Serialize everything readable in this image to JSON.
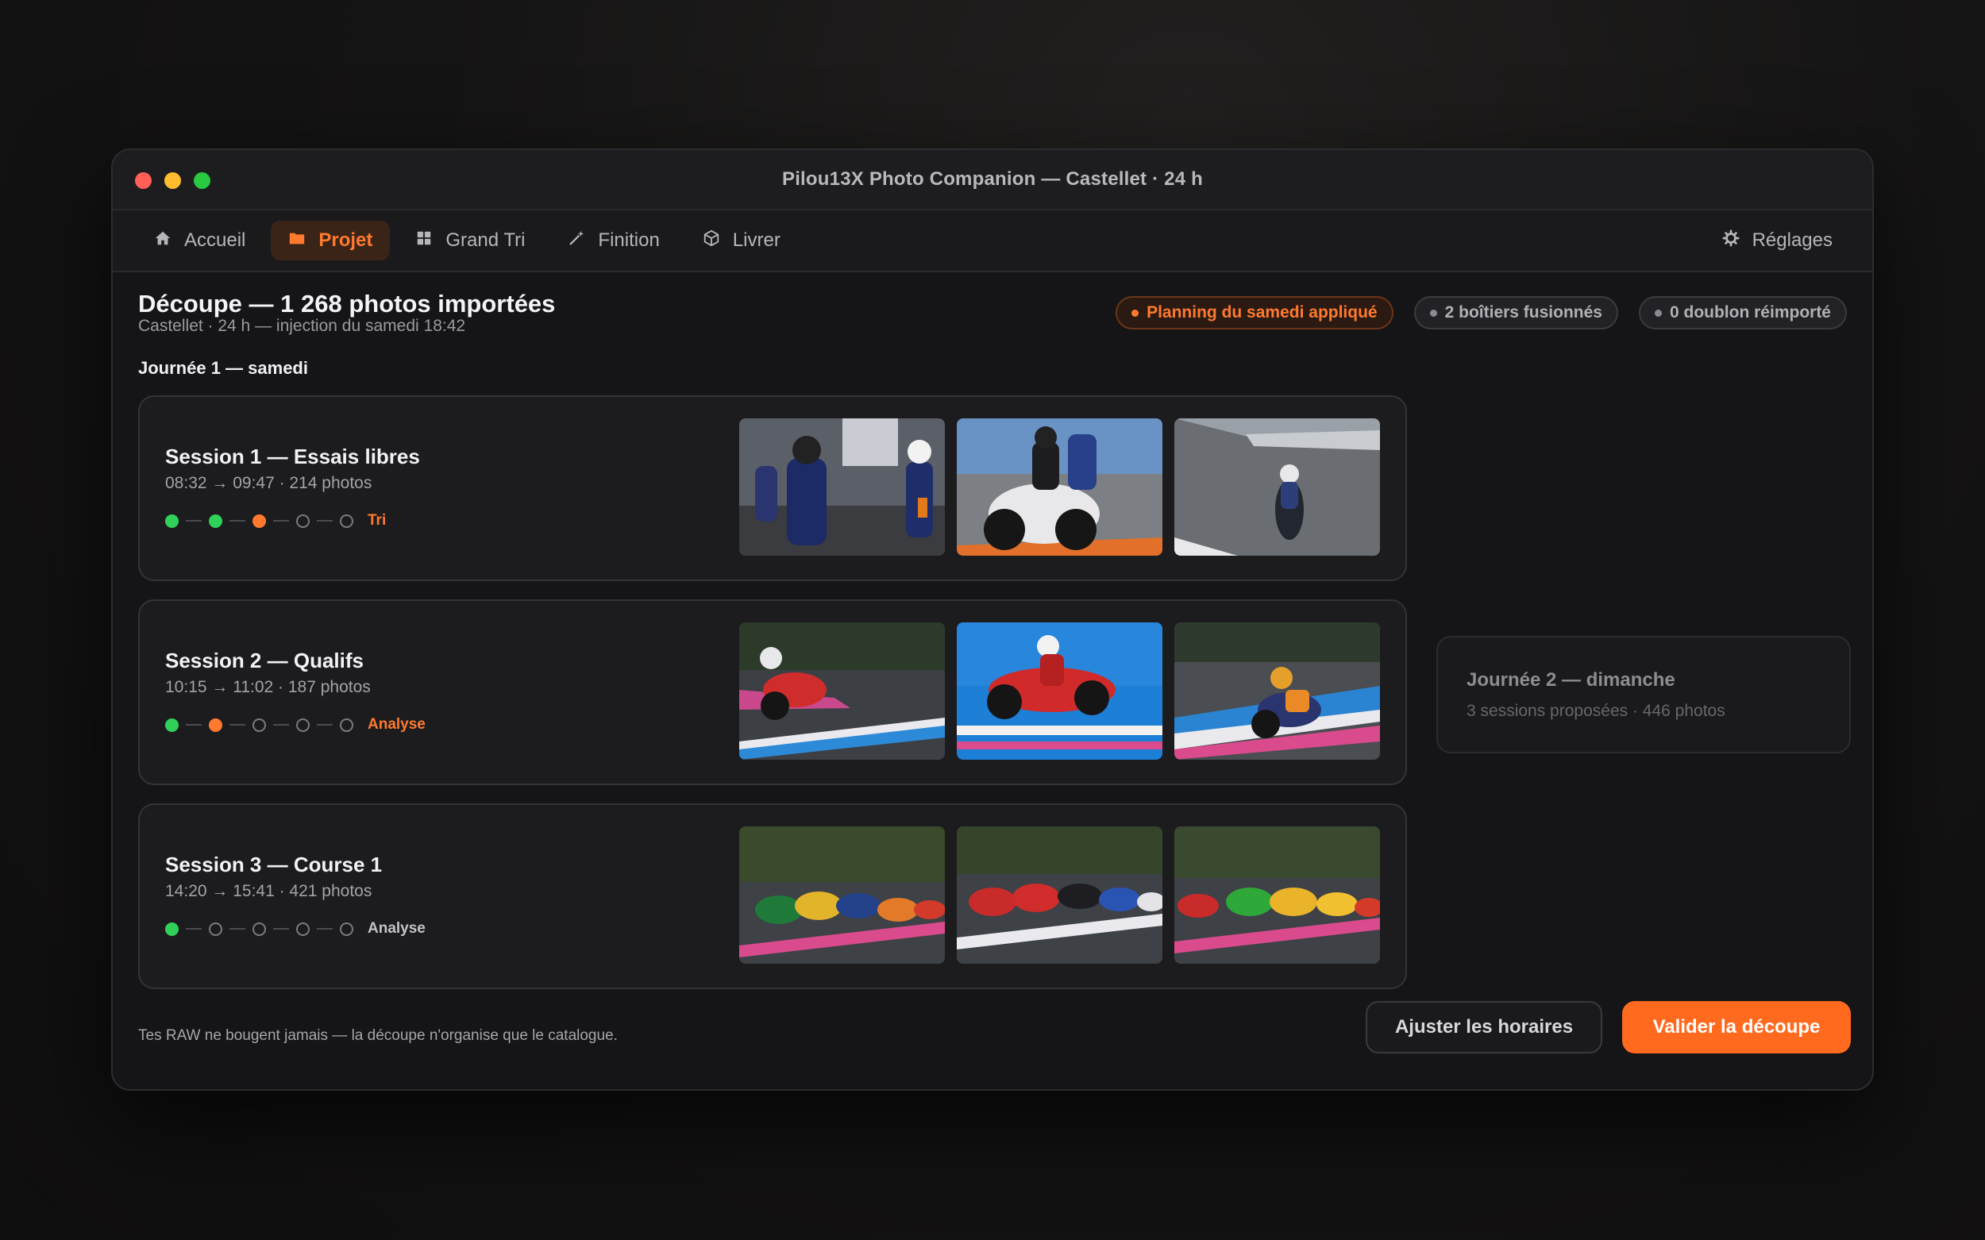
{
  "window": {
    "title": "Pilou13X Photo Companion — Castellet · 24 h"
  },
  "nav": {
    "items": [
      {
        "label": "Accueil",
        "icon": "home-icon",
        "active": false
      },
      {
        "label": "Projet",
        "icon": "folder-icon",
        "active": true
      },
      {
        "label": "Grand Tri",
        "icon": "grid-icon",
        "active": false
      },
      {
        "label": "Finition",
        "icon": "magic-wand-icon",
        "active": false
      },
      {
        "label": "Livrer",
        "icon": "package-icon",
        "active": false
      }
    ],
    "settings": {
      "label": "Réglages",
      "icon": "gear-icon"
    }
  },
  "header": {
    "title": "Découpe — 1 268 photos importées",
    "subtitle": "Castellet · 24 h — injection du samedi 18:42"
  },
  "badges": [
    {
      "label": "Planning du samedi appliqué",
      "tone": "orange"
    },
    {
      "label": "2 boîtiers fusionnés",
      "tone": "grey"
    },
    {
      "label": "0 doublon réimporté",
      "tone": "grey"
    }
  ],
  "day1": {
    "label": "Journée 1 — samedi",
    "sessions": [
      {
        "title": "Session 1 — Essais libres",
        "meta": "08:32 → 09:47 · 214 photos",
        "stages": [
          "done",
          "done",
          "active",
          "pending",
          "pending"
        ],
        "stage_label": "Tri",
        "stage_tone": "orange"
      },
      {
        "title": "Session 2 — Qualifs",
        "meta": "10:15 → 11:02 · 187 photos",
        "stages": [
          "done",
          "active",
          "pending",
          "pending",
          "pending"
        ],
        "stage_label": "Analyse",
        "stage_tone": "orange"
      },
      {
        "title": "Session 3 — Course 1",
        "meta": "14:20 → 15:41 · 421 photos",
        "stages": [
          "done",
          "pending",
          "pending",
          "pending",
          "pending"
        ],
        "stage_label": "Analyse",
        "stage_tone": "grey"
      }
    ]
  },
  "day2": {
    "title": "Journée 2 — dimanche",
    "meta": "3 sessions proposées · 446 photos"
  },
  "footer": {
    "note": "Tes RAW ne bougent jamais — la découpe n'organise que le catalogue.",
    "secondary_button": "Ajuster les horaires",
    "primary_button": "Valider la découpe"
  },
  "colors": {
    "accent": "#ff6a1f",
    "done": "#2fd158",
    "background": "#151517"
  }
}
